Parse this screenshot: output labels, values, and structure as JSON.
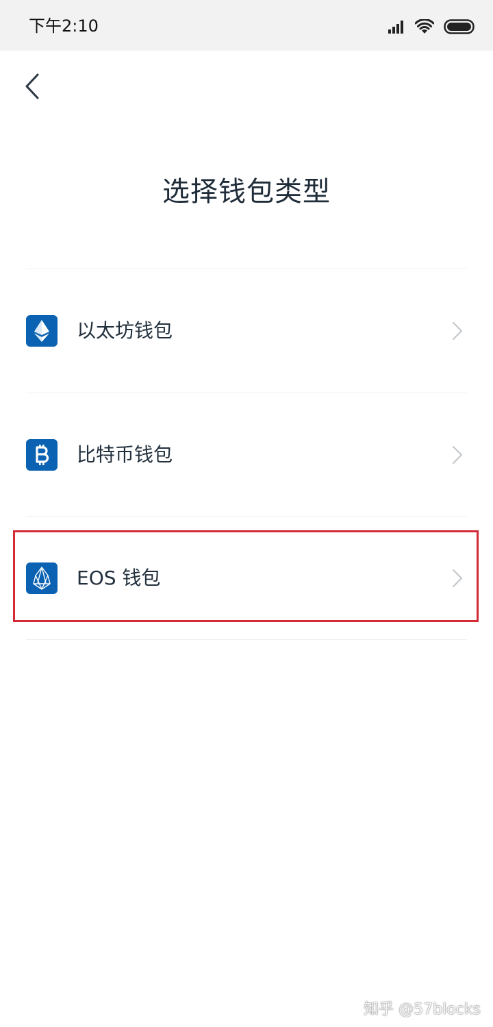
{
  "status_bar": {
    "time": "下午2:10"
  },
  "page": {
    "title": "选择钱包类型"
  },
  "wallets": [
    {
      "label": "以太坊钱包",
      "icon": "ethereum-icon"
    },
    {
      "label": "比特币钱包",
      "icon": "bitcoin-icon"
    },
    {
      "label": "EOS 钱包",
      "icon": "eos-icon"
    }
  ],
  "watermark": {
    "text": "知乎 @57blocks"
  },
  "colors": {
    "icon_background": "#0b62b2",
    "highlight_border": "#d42a36",
    "status_bar_background": "#f2f2f2"
  }
}
